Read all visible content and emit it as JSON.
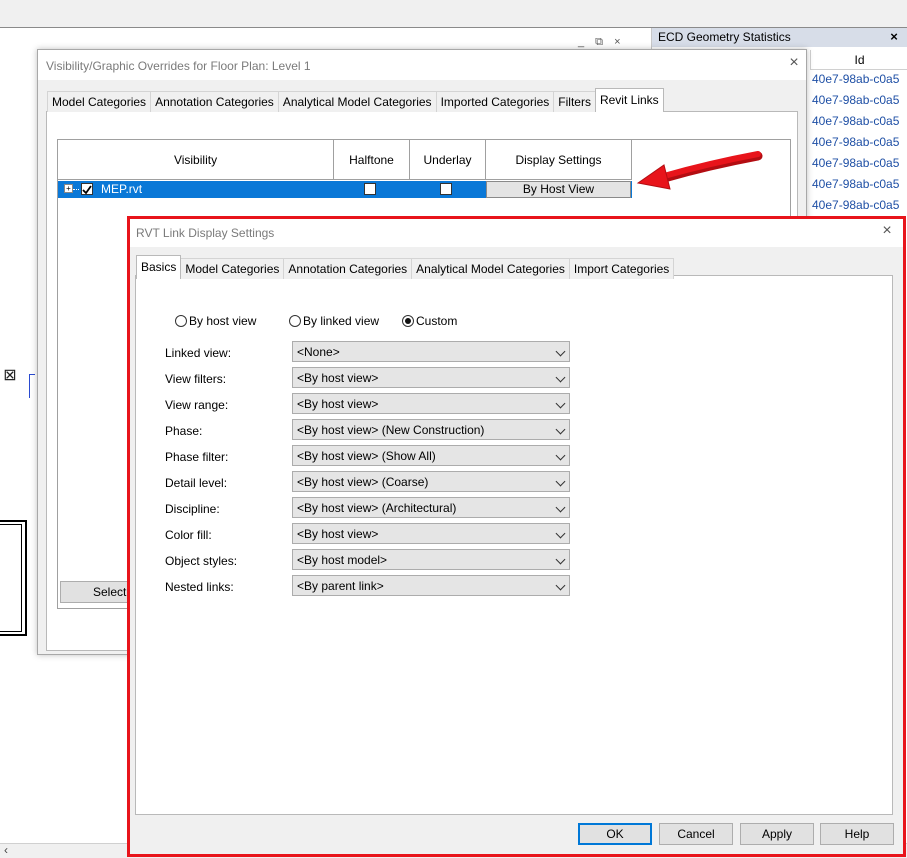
{
  "ecd_panel": {
    "title": "ECD Geometry Statistics",
    "close_glyph": "×",
    "column_header": "Id",
    "rows": [
      "40e7-98ab-c0a5",
      "40e7-98ab-c0a5",
      "40e7-98ab-c0a5",
      "40e7-98ab-c0a5",
      "40e7-98ab-c0a5",
      "40e7-98ab-c0a5",
      "40e7-98ab-c0a5"
    ]
  },
  "doc_controls": "_ ⧉ ×",
  "vg_dialog": {
    "title": "Visibility/Graphic Overrides for Floor Plan: Level 1",
    "close_glyph": "×",
    "tabs": [
      "Model Categories",
      "Annotation Categories",
      "Analytical Model Categories",
      "Imported Categories",
      "Filters",
      "Revit Links"
    ],
    "active_tab": "Revit Links",
    "columns": [
      "Visibility",
      "Halftone",
      "Underlay",
      "Display Settings"
    ],
    "row": {
      "name": "MEP.rvt",
      "visible": true,
      "halftone": false,
      "underlay": false,
      "display_settings": "By Host View"
    },
    "select_all_button": "Select All"
  },
  "rvt_dialog": {
    "title": "RVT Link Display Settings",
    "close_glyph": "×",
    "tabs": [
      "Basics",
      "Model Categories",
      "Annotation Categories",
      "Analytical Model Categories",
      "Import Categories"
    ],
    "active_tab": "Basics",
    "radios": [
      {
        "label": "By host view",
        "selected": false
      },
      {
        "label": "By linked view",
        "selected": false
      },
      {
        "label": "Custom",
        "selected": true
      }
    ],
    "fields": [
      {
        "label": "Linked view:",
        "value": "<None>"
      },
      {
        "label": "View filters:",
        "value": "<By host view>"
      },
      {
        "label": "View range:",
        "value": "<By host view>"
      },
      {
        "label": "Phase:",
        "value": "<By host view> (New Construction)"
      },
      {
        "label": "Phase filter:",
        "value": "<By host view> (Show All)"
      },
      {
        "label": "Detail level:",
        "value": "<By host view> (Coarse)"
      },
      {
        "label": "Discipline:",
        "value": "<By host view> (Architectural)"
      },
      {
        "label": "Color fill:",
        "value": "<By host view>"
      },
      {
        "label": "Object styles:",
        "value": "<By host model>"
      },
      {
        "label": "Nested links:",
        "value": "<By parent link>"
      }
    ],
    "buttons": {
      "ok": "OK",
      "cancel": "Cancel",
      "apply": "Apply",
      "help": "Help"
    }
  },
  "colors": {
    "highlight_border": "#e8141b",
    "selection": "#0a78d7",
    "link_text": "#1e4fa5"
  }
}
